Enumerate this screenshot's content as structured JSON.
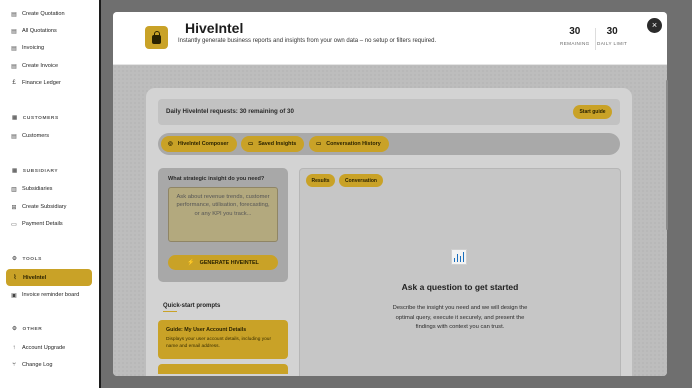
{
  "sidebar": {
    "items_top": [
      {
        "label": "Create Quotation",
        "icon": "document-icon",
        "glyph": "▤"
      },
      {
        "label": "All Quotations",
        "icon": "document-icon",
        "glyph": "▤"
      },
      {
        "label": "Invoicing",
        "icon": "document-icon",
        "glyph": "▤"
      },
      {
        "label": "Create Invoice",
        "icon": "document-icon",
        "glyph": "▤"
      },
      {
        "label": "Finance Ledger",
        "icon": "pound-icon",
        "glyph": "£"
      }
    ],
    "sections": {
      "customers": {
        "title": "CUSTOMERS",
        "glyph": "▦"
      },
      "subsidiary": {
        "title": "SUBSIDIARY",
        "glyph": "▦"
      },
      "tools": {
        "title": "TOOLS",
        "glyph": "⚙"
      },
      "other": {
        "title": "OTHER",
        "glyph": "⚙"
      }
    },
    "customers_items": [
      {
        "label": "Customers",
        "glyph": "▤"
      }
    ],
    "subsidiary_items": [
      {
        "label": "Subsidiaries",
        "glyph": "▥"
      },
      {
        "label": "Create Subsidiary",
        "glyph": "⊞"
      },
      {
        "label": "Payment Details",
        "glyph": "▭"
      }
    ],
    "tools_items": [
      {
        "label": "HiveIntel",
        "glyph": "⌇",
        "active": true
      },
      {
        "label": "Invoice reminder board",
        "glyph": "▣"
      }
    ],
    "other_items": [
      {
        "label": "Account Upgrade",
        "glyph": "↑"
      },
      {
        "label": "Change Log",
        "glyph": "⑂"
      }
    ]
  },
  "modal": {
    "title": "HiveIntel",
    "subtitle": "Instantly generate business reports and insights from your own data – no setup or filters required.",
    "stats": {
      "remaining_value": "30",
      "remaining_label": "REMAINING",
      "limit_value": "30",
      "limit_label": "DAILY LIMIT"
    },
    "close_glyph": "×",
    "banner": {
      "text": "Daily HiveIntel requests: 30 remaining of 30",
      "start_guide": "Start guide"
    },
    "tabs": [
      {
        "label": "HiveIntel Composer",
        "glyph": "◎"
      },
      {
        "label": "Saved Insights",
        "glyph": "▭"
      },
      {
        "label": "Conversation History",
        "glyph": "▭"
      }
    ],
    "composer": {
      "question_label": "What strategic insight do you need?",
      "placeholder": "Ask about revenue trends, customer performance, utilisation, forecasting, or any KPI you track...",
      "generate_label": "GENERATE HIVEINTEL",
      "generate_glyph": "⚡"
    },
    "quick_start": {
      "title": "Quick-start prompts",
      "cards": [
        {
          "title": "Guide: My User Account Details",
          "desc": "Displays your user account details, including your name and email address."
        }
      ]
    },
    "results": {
      "tabs": [
        "Results",
        "Conversation"
      ],
      "empty_title": "Ask a question to get started",
      "empty_desc": "Describe the insight you need and we will design the optimal query, execute it securely, and present the findings with context you can trust."
    }
  },
  "colors": {
    "accent": "#c9a227",
    "overlay": "#6f6f6f",
    "sidebar_bg": "#ffffff"
  }
}
